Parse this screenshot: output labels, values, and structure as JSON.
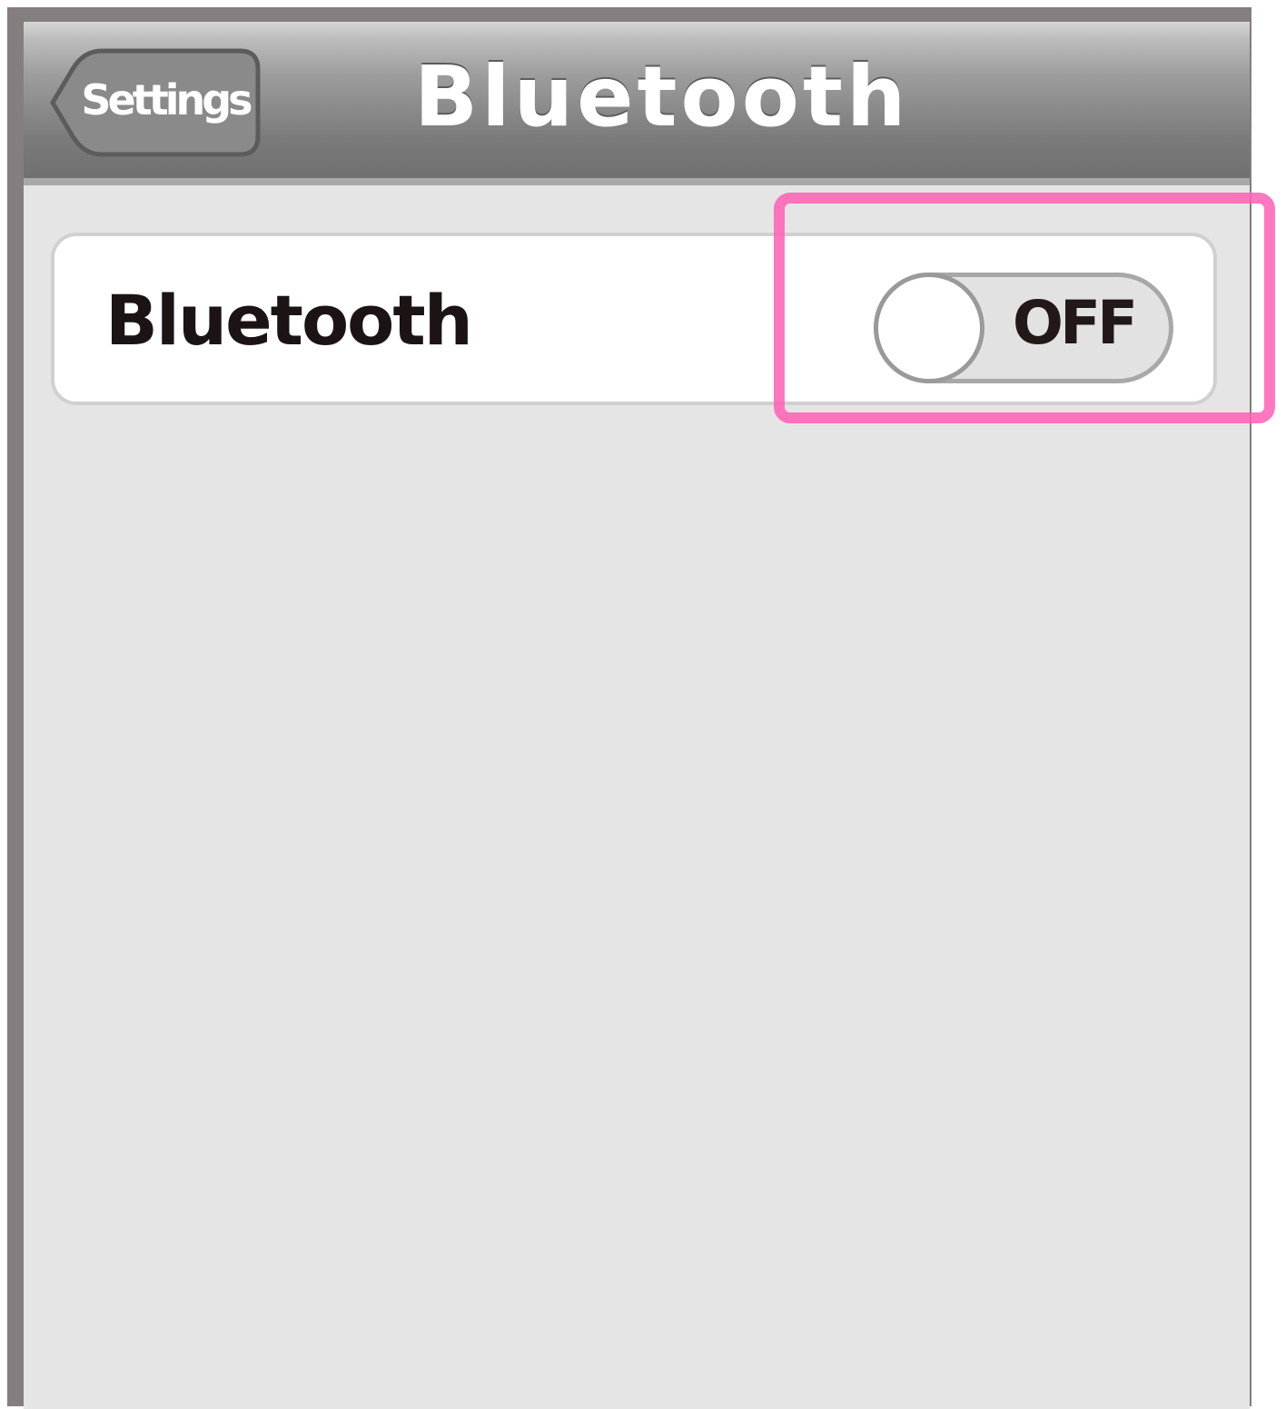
{
  "navbar": {
    "title": "Bluetooth",
    "back_label": "Settings"
  },
  "settings": {
    "bluetooth": {
      "label": "Bluetooth",
      "toggle_state": "OFF"
    }
  },
  "colors": {
    "highlight": "#ff5fb4",
    "navbar": "#6e6e6e",
    "background": "#e5e5e5"
  }
}
